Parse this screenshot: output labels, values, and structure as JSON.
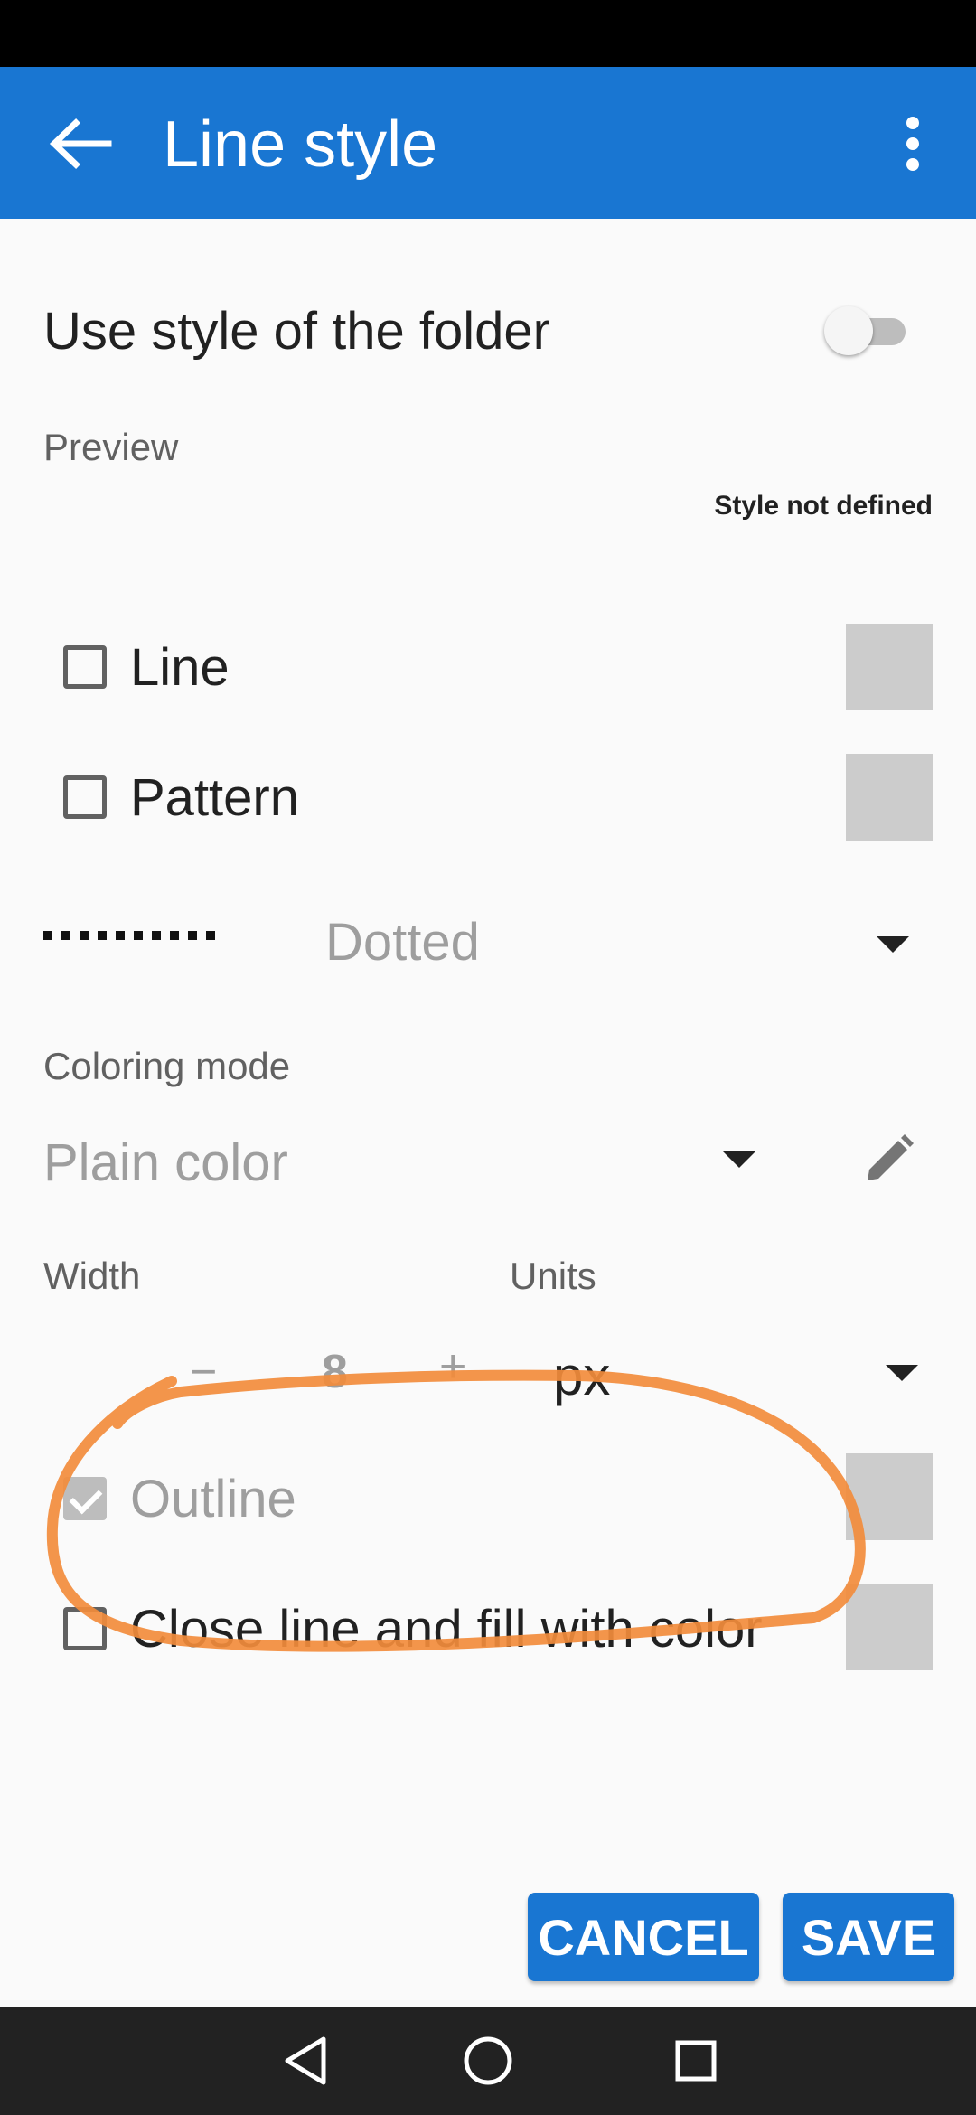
{
  "app_bar": {
    "title": "Line style",
    "back_icon": "arrow-back-icon",
    "menu_icon": "more-vert-icon",
    "color": "#1976d2"
  },
  "use_folder_style": {
    "label": "Use style of the folder",
    "enabled": false
  },
  "preview": {
    "label": "Preview",
    "status": "Style not defined"
  },
  "options": {
    "line": {
      "label": "Line",
      "checked": false
    },
    "pattern": {
      "label": "Pattern",
      "checked": false
    },
    "outline": {
      "label": "Outline",
      "checked": true
    },
    "close_fill": {
      "label": "Close line and fill with color",
      "checked": false
    }
  },
  "line_type": {
    "value": "Dotted"
  },
  "coloring": {
    "label": "Coloring mode",
    "value": "Plain color"
  },
  "width": {
    "label": "Width",
    "minus": "−",
    "value": "8",
    "plus": "+"
  },
  "units": {
    "label": "Units",
    "value": "px"
  },
  "buttons": {
    "cancel": "CANCEL",
    "save": "SAVE"
  },
  "annotation_color": "#f28c3c"
}
